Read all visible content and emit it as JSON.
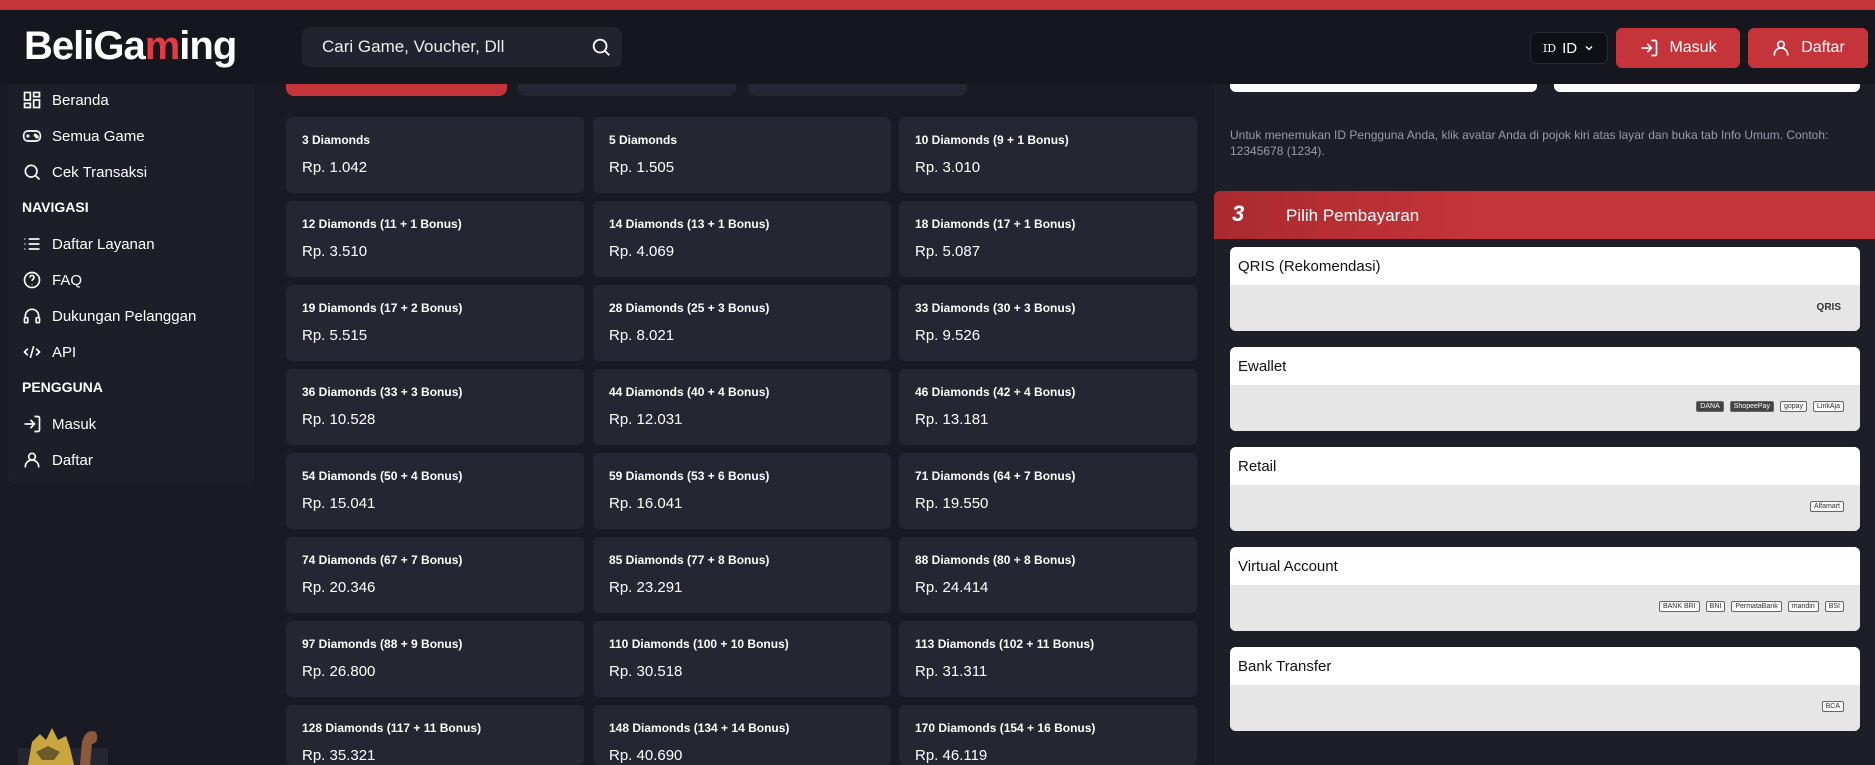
{
  "header": {
    "logo_prefix": "BeliGa",
    "logo_mid": "m",
    "logo_suffix": "ing",
    "search_placeholder": "Cari Game, Voucher, Dll",
    "lang_flag": "ID",
    "lang_code": "ID",
    "login_label": "Masuk",
    "register_label": "Daftar"
  },
  "sidebar": {
    "items": [
      {
        "label": "Beranda",
        "icon": "grid-icon"
      },
      {
        "label": "Semua Game",
        "icon": "gamepad-icon"
      },
      {
        "label": "Cek Transaksi",
        "icon": "search-icon"
      }
    ],
    "nav_heading": "NAVIGASI",
    "nav_items": [
      {
        "label": "Daftar Layanan",
        "icon": "list-icon"
      },
      {
        "label": "FAQ",
        "icon": "help-icon"
      },
      {
        "label": "Dukungan Pelanggan",
        "icon": "headset-icon"
      },
      {
        "label": "API",
        "icon": "code-icon"
      }
    ],
    "user_heading": "PENGGUNA",
    "user_items": [
      {
        "label": "Masuk",
        "icon": "login-icon"
      },
      {
        "label": "Daftar",
        "icon": "user-icon"
      }
    ]
  },
  "products": [
    {
      "name": "3 Diamonds",
      "price": "Rp. 1.042"
    },
    {
      "name": "5 Diamonds",
      "price": "Rp. 1.505"
    },
    {
      "name": "10 Diamonds (9 + 1 Bonus)",
      "price": "Rp. 3.010"
    },
    {
      "name": "12 Diamonds (11 + 1 Bonus)",
      "price": "Rp. 3.510"
    },
    {
      "name": "14 Diamonds (13 + 1 Bonus)",
      "price": "Rp. 4.069"
    },
    {
      "name": "18 Diamonds (17 + 1 Bonus)",
      "price": "Rp. 5.087"
    },
    {
      "name": "19 Diamonds (17 + 2 Bonus)",
      "price": "Rp. 5.515"
    },
    {
      "name": "28 Diamonds (25 + 3 Bonus)",
      "price": "Rp. 8.021"
    },
    {
      "name": "33 Diamonds (30 + 3 Bonus)",
      "price": "Rp. 9.526"
    },
    {
      "name": "36 Diamonds (33 + 3 Bonus)",
      "price": "Rp. 10.528"
    },
    {
      "name": "44 Diamonds (40 + 4 Bonus)",
      "price": "Rp. 12.031"
    },
    {
      "name": "46 Diamonds (42 + 4 Bonus)",
      "price": "Rp. 13.181"
    },
    {
      "name": "54 Diamonds (50 + 4 Bonus)",
      "price": "Rp. 15.041"
    },
    {
      "name": "59 Diamonds (53 + 6 Bonus)",
      "price": "Rp. 16.041"
    },
    {
      "name": "71 Diamonds (64 + 7 Bonus)",
      "price": "Rp. 19.550"
    },
    {
      "name": "74 Diamonds (67 + 7 Bonus)",
      "price": "Rp. 20.346"
    },
    {
      "name": "85 Diamonds (77 + 8 Bonus)",
      "price": "Rp. 23.291"
    },
    {
      "name": "88 Diamonds (80 + 8 Bonus)",
      "price": "Rp. 24.414"
    },
    {
      "name": "97 Diamonds (88 + 9 Bonus)",
      "price": "Rp. 26.800"
    },
    {
      "name": "110 Diamonds (100 + 10 Bonus)",
      "price": "Rp. 30.518"
    },
    {
      "name": "113 Diamonds (102 + 11 Bonus)",
      "price": "Rp. 31.311"
    },
    {
      "name": "128 Diamonds (117 + 11 Bonus)",
      "price": "Rp. 35.321"
    },
    {
      "name": "148 Diamonds (134 + 14 Bonus)",
      "price": "Rp. 40.690"
    },
    {
      "name": "170 Diamonds (154 + 16 Bonus)",
      "price": "Rp. 46.119"
    }
  ],
  "right": {
    "help_text": "Untuk menemukan ID Pengguna Anda, klik avatar Anda di pojok kiri atas layar dan buka tab Info Umum. Contoh: 12345678 (1234).",
    "step_number": "3",
    "step_title": "Pilih Pembayaran",
    "payments": [
      {
        "label": "QRIS (Rekomendasi)",
        "logos": [
          "QRIS"
        ]
      },
      {
        "label": "Ewallet",
        "logos": [
          "DANA",
          "ShopeePay",
          "gopay",
          "LinkAja"
        ]
      },
      {
        "label": "Retail",
        "logos": [
          "Alfamart"
        ]
      },
      {
        "label": "Virtual Account",
        "logos": [
          "BANK BRI",
          "BNI",
          "PermataBank",
          "mandiri",
          "BSI"
        ]
      },
      {
        "label": "Bank Transfer",
        "logos": [
          "BCA"
        ]
      }
    ]
  },
  "colors": {
    "accent": "#c4343a",
    "background": "#1a1a24",
    "card": "#262633",
    "panel": "#1e1e29"
  }
}
